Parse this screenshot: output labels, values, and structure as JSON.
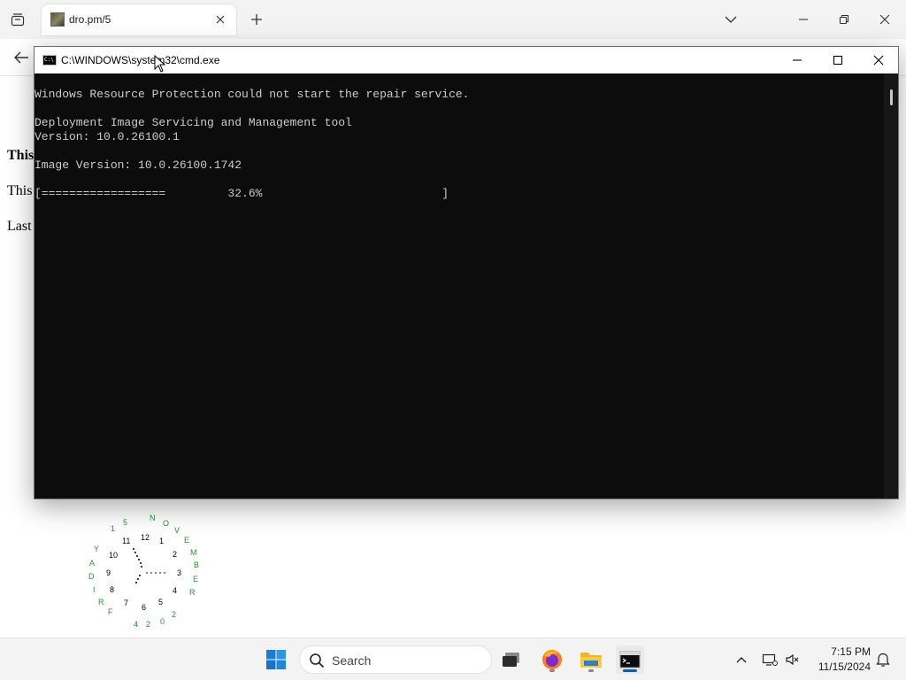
{
  "browser": {
    "tab": {
      "title": "dro.pm/5"
    },
    "new_tab_symbol": "+",
    "icons": {
      "tab_list": "tab-list-icon",
      "close_tab": "close-icon",
      "tab_dropdown": "chevron-down-icon",
      "minimize": "minimize-icon",
      "restore": "restore-icon",
      "close_window": "close-icon",
      "back": "back-arrow-icon"
    }
  },
  "page": {
    "lines": [
      "This",
      "This",
      "Last"
    ]
  },
  "clock": {
    "hours": [
      "12",
      "1",
      "2",
      "3",
      "4",
      "5",
      "6",
      "7",
      "8",
      "9",
      "10",
      "11"
    ],
    "decorations": [
      "1",
      "5",
      "N",
      "O",
      "V",
      "E",
      "M",
      "B",
      "E",
      "R",
      "2",
      "0",
      "2",
      "4",
      "F",
      "R",
      "I",
      "D",
      "A",
      "Y"
    ],
    "hand_color": "#1f9a1f"
  },
  "cmd": {
    "title": "C:\\WINDOWS\\system32\\cmd.exe",
    "lines": [
      "Windows Resource Protection could not start the repair service.",
      "",
      "Deployment Image Servicing and Management tool",
      "Version: 10.0.26100.1",
      "",
      "Image Version: 10.0.26100.1742",
      "",
      "[==================         32.6%                          ]"
    ],
    "progress_percent": 32.6,
    "colors": {
      "background": "#0c0c0c",
      "text": "#cccccc"
    }
  },
  "taskbar": {
    "search_label": "Search",
    "apps": [
      {
        "name": "Task View",
        "icon": "task-view-icon",
        "active": false
      },
      {
        "name": "Firefox",
        "icon": "firefox-icon",
        "active": false
      },
      {
        "name": "File Explorer",
        "icon": "folder-icon",
        "active": false
      },
      {
        "name": "Command Prompt",
        "icon": "terminal-icon",
        "active": true
      }
    ],
    "tray": {
      "time": "7:15 PM",
      "date": "11/15/2024",
      "icons": [
        "chevron-up-icon",
        "network-icon",
        "volume-muted-icon",
        "notification-icon"
      ]
    },
    "accent_color": "#005fb8"
  }
}
